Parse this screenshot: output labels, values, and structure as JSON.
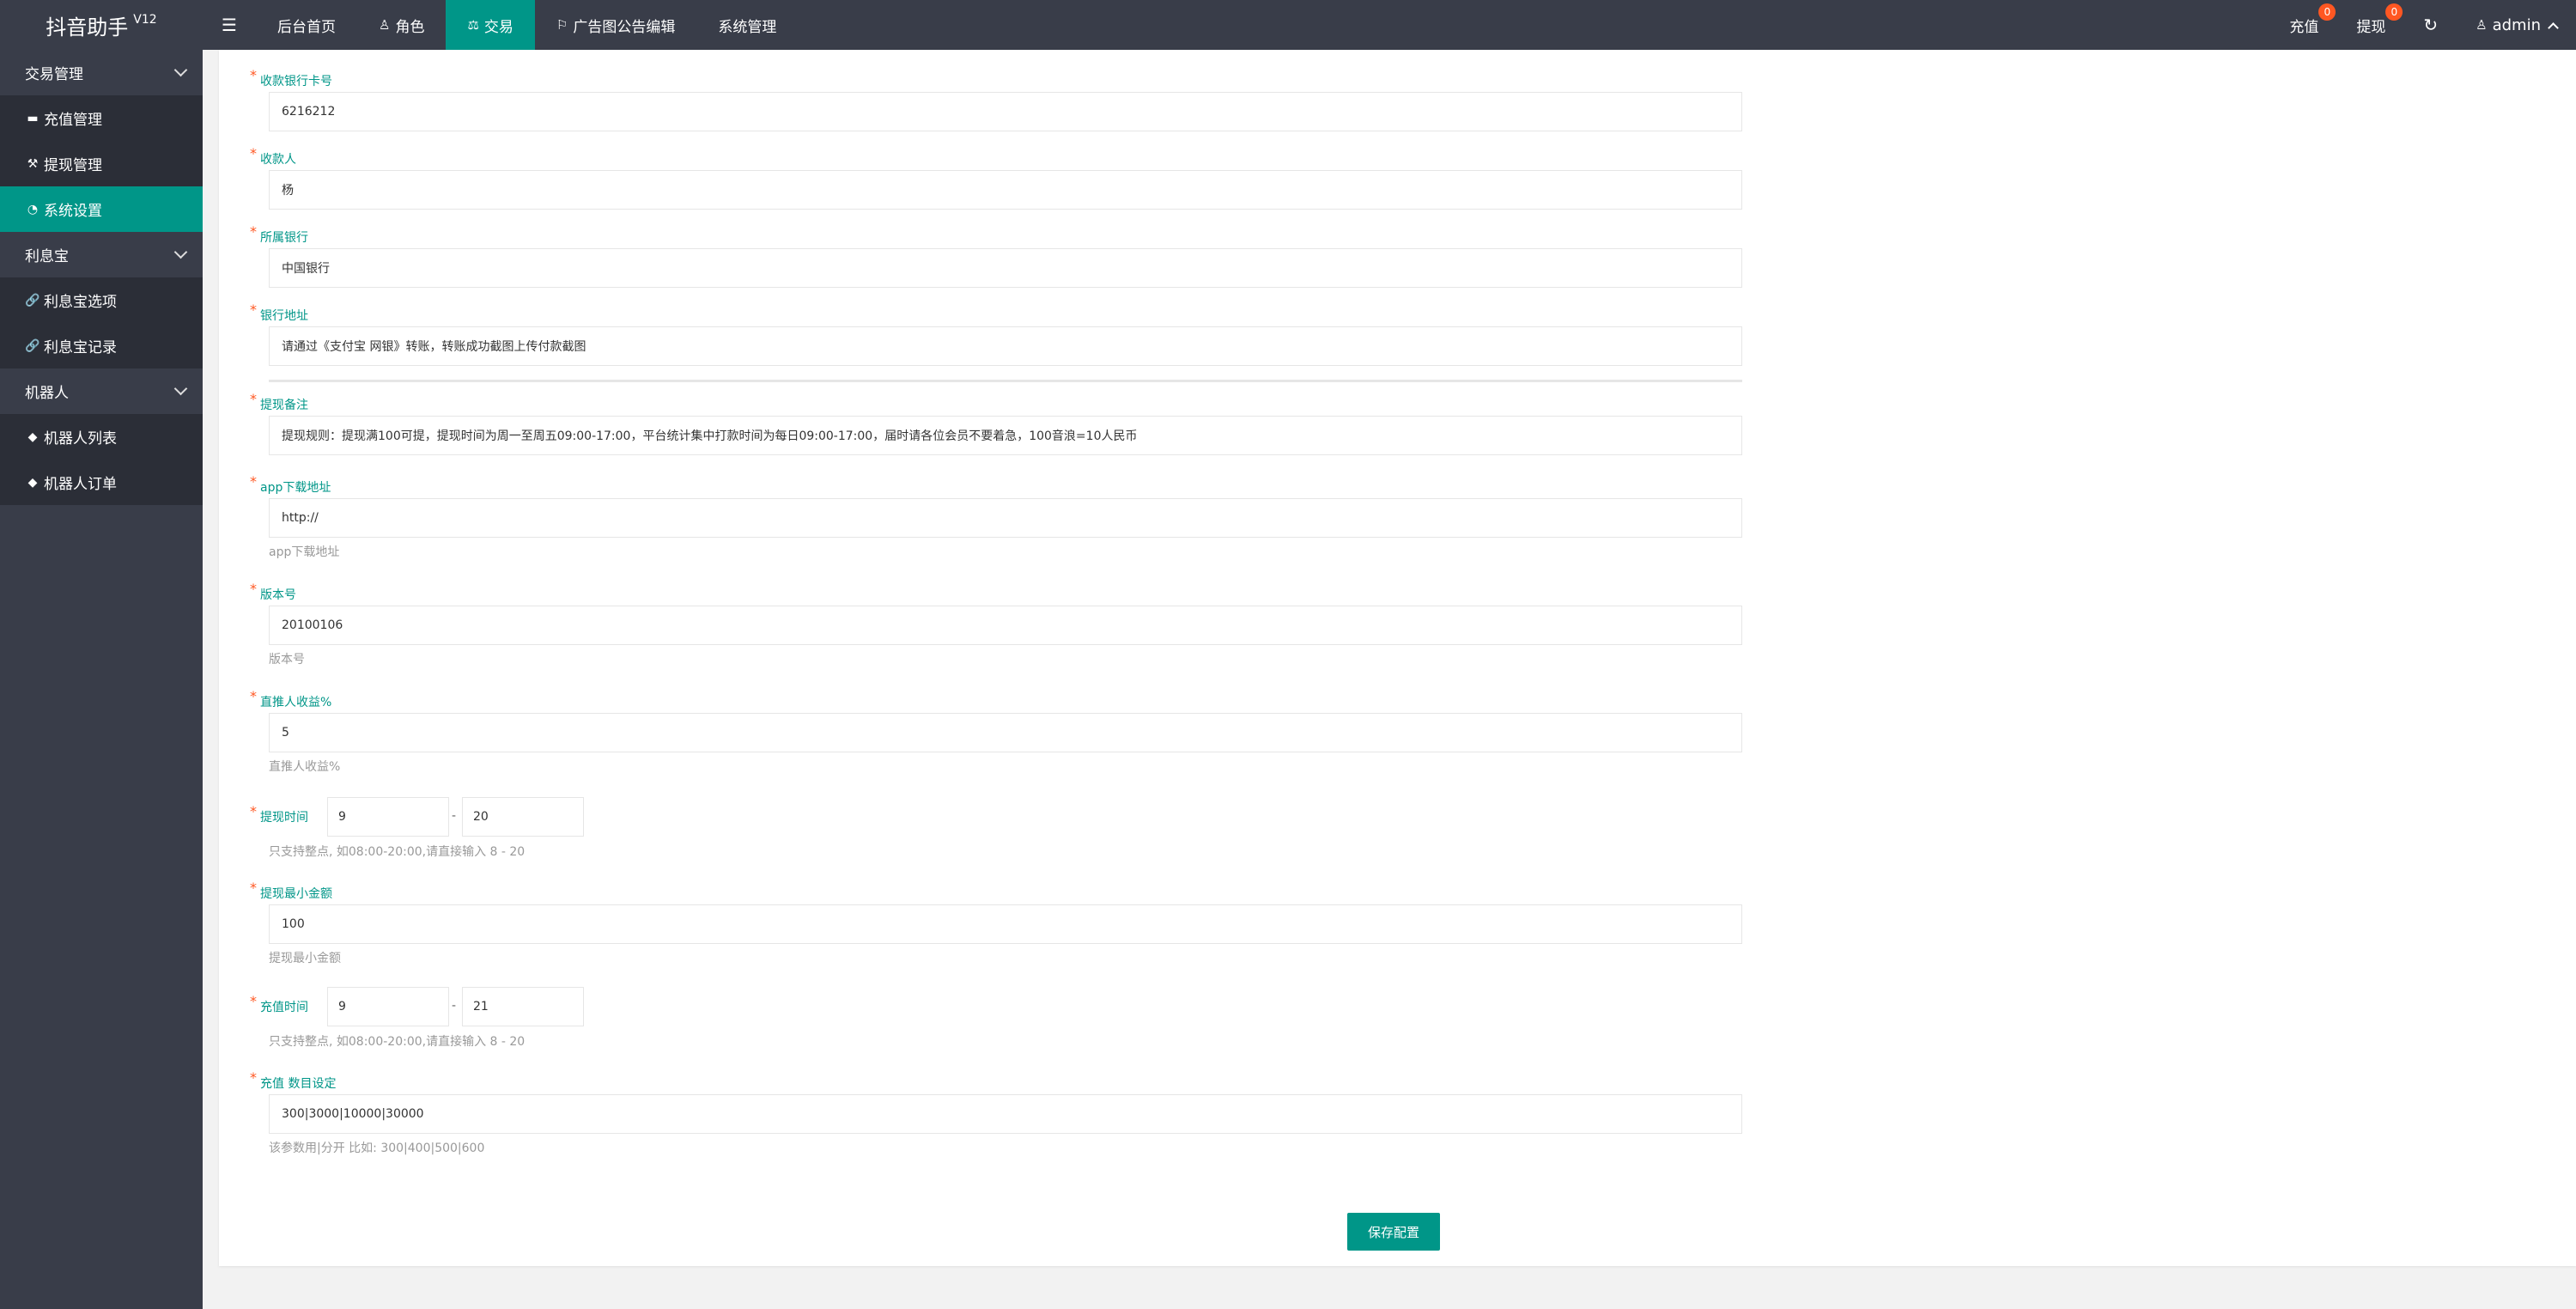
{
  "app": {
    "title": "抖音助手",
    "version": "V12"
  },
  "sidebar": {
    "groups": [
      {
        "label": "交易管理",
        "items": [
          {
            "label": "充值管理",
            "icon": "chat-icon"
          },
          {
            "label": "提现管理",
            "icon": "hammer-icon"
          },
          {
            "label": "系统设置",
            "icon": "dashboard-icon",
            "active": true
          }
        ]
      },
      {
        "label": "利息宝",
        "items": [
          {
            "label": "利息宝选项",
            "icon": "link-icon"
          },
          {
            "label": "利息宝记录",
            "icon": "link-icon"
          }
        ]
      },
      {
        "label": "机器人",
        "items": [
          {
            "label": "机器人列表",
            "icon": "diamond-icon"
          },
          {
            "label": "机器人订单",
            "icon": "diamond-icon"
          }
        ]
      }
    ]
  },
  "topnav": {
    "menu_icon": "☰",
    "links": [
      {
        "label": "后台首页",
        "icon": ""
      },
      {
        "label": "角色",
        "icon": "user-icon"
      },
      {
        "label": "交易",
        "icon": "scale-icon",
        "active": true
      },
      {
        "label": "广告图公告编辑",
        "icon": "flag-icon"
      },
      {
        "label": "系统管理",
        "icon": ""
      }
    ],
    "recharge": {
      "label": "充值",
      "badge": "0"
    },
    "withdraw": {
      "label": "提现",
      "badge": "0"
    },
    "refresh_icon": "↻",
    "user": "admin"
  },
  "form": {
    "bank_card": {
      "label": "收款银行卡号",
      "value": "6216212"
    },
    "payee": {
      "label": "收款人",
      "value": "杨"
    },
    "bank": {
      "label": "所属银行",
      "value": "中国银行"
    },
    "bank_address": {
      "label": "银行地址",
      "value": "请通过《支付宝 网银》转账，转账成功截图上传付款截图"
    },
    "withdraw_note": {
      "label": "提现备注",
      "value": "提现规则：提现满100可提，提现时间为周一至周五09:00-17:00，平台统计集中打款时间为每日09:00-17:00，届时请各位会员不要着急，100音浪=10人民币"
    },
    "app_url": {
      "label": "app下载地址",
      "value": "http://",
      "help": "app下载地址"
    },
    "version": {
      "label": "版本号",
      "value": "20100106",
      "help": "版本号"
    },
    "referral_pct": {
      "label": "直推人收益%",
      "value": "5",
      "help": "直推人收益%"
    },
    "withdraw_time": {
      "label": "提现时间",
      "from": "9",
      "to": "20",
      "sep": "-",
      "help": "只支持整点, 如08:00-20:00,请直接输入 8 - 20"
    },
    "withdraw_min": {
      "label": "提现最小金额",
      "value": "100",
      "help": "提现最小金额"
    },
    "recharge_time": {
      "label": "充值时间",
      "from": "9",
      "to": "21",
      "sep": "-",
      "help": "只支持整点, 如08:00-20:00,请直接输入 8 - 20"
    },
    "recharge_amounts": {
      "label": "充值 数目设定",
      "value": "300|3000|10000|30000",
      "help": "该参数用|分开 比如:   300|400|500|600"
    },
    "save_label": "保存配置"
  }
}
